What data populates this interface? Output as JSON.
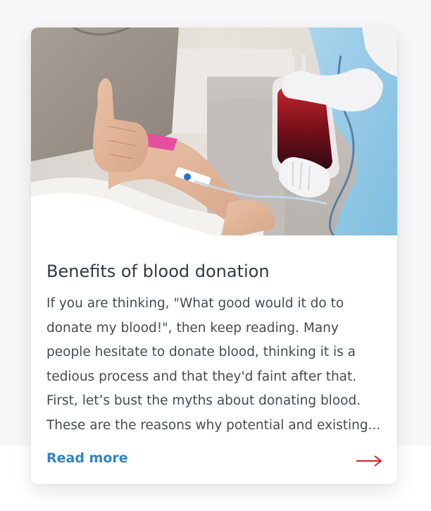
{
  "card": {
    "image_alt": "Patient giving thumbs up while donating blood, nurse holding blood bag",
    "title": "Benefits of blood donation",
    "excerpt": "If you are thinking, \"What good would it do to donate my blood!\", then keep reading. Many people hesitate to donate blood, thinking it is a tedious process and that they'd faint after that. First, let’s bust the myths about donating blood. These are the reasons why potential and existing...",
    "read_more_label": "Read more",
    "arrow_icon": "arrow-right-icon"
  },
  "colors": {
    "link": "#3383c2",
    "arrow": "#c8262c",
    "title": "#333a40",
    "text": "#454b52"
  }
}
